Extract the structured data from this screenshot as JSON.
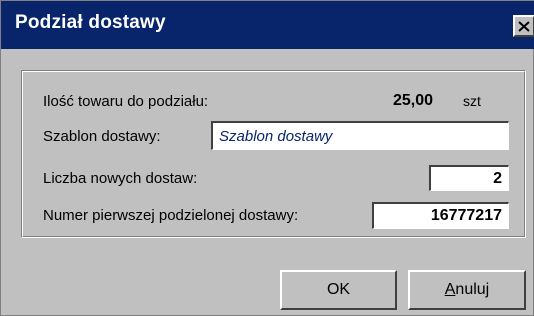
{
  "window": {
    "title": "Podział dostawy"
  },
  "form": {
    "quantity_label": "Ilość towaru do podziału:",
    "quantity_value": "25,00",
    "quantity_unit": "szt",
    "template_label": "Szablon dostawy:",
    "template_placeholder": "Szablon dostawy",
    "new_count_label": "Liczba nowych dostaw:",
    "new_count_value": "2",
    "first_number_label": "Numer pierwszej podzielonej dostawy:",
    "first_number_value": "16777217"
  },
  "buttons": {
    "ok_label": "OK",
    "cancel_label_underlined": "A",
    "cancel_label_rest": "nuluj"
  },
  "colors": {
    "titlebar": "#08246b",
    "dialog_bg": "#c0c0c0"
  }
}
